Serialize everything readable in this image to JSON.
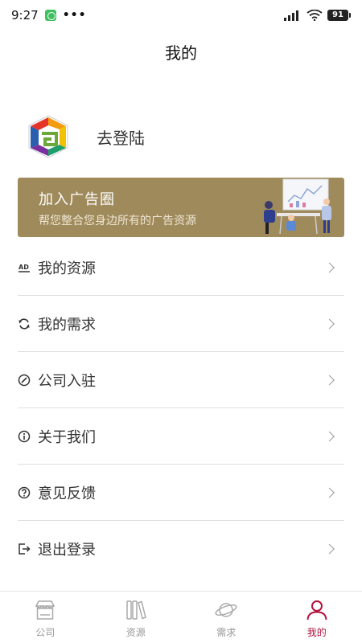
{
  "status": {
    "time": "9:27",
    "dots": "•••",
    "battery": "91"
  },
  "header": {
    "title": "我的"
  },
  "profile": {
    "login_label": "去登陆"
  },
  "banner": {
    "title": "加入广告圈",
    "subtitle": "帮您整合您身边所有的广告资源"
  },
  "menu": {
    "items": [
      {
        "label": "我的资源",
        "icon": "ad-icon"
      },
      {
        "label": "我的需求",
        "icon": "refresh-icon"
      },
      {
        "label": "公司入驻",
        "icon": "compass-icon"
      },
      {
        "label": "关于我们",
        "icon": "info-icon"
      },
      {
        "label": "意见反馈",
        "icon": "question-icon"
      },
      {
        "label": "退出登录",
        "icon": "logout-icon"
      }
    ]
  },
  "tabbar": {
    "tabs": [
      {
        "label": "公司",
        "icon": "store-icon",
        "active": false
      },
      {
        "label": "资源",
        "icon": "books-icon",
        "active": false
      },
      {
        "label": "需求",
        "icon": "planet-icon",
        "active": false
      },
      {
        "label": "我的",
        "icon": "user-icon",
        "active": true
      }
    ]
  },
  "colors": {
    "accent": "#b0143f",
    "banner_bg": "#9f8a5c",
    "inactive": "#999999"
  }
}
